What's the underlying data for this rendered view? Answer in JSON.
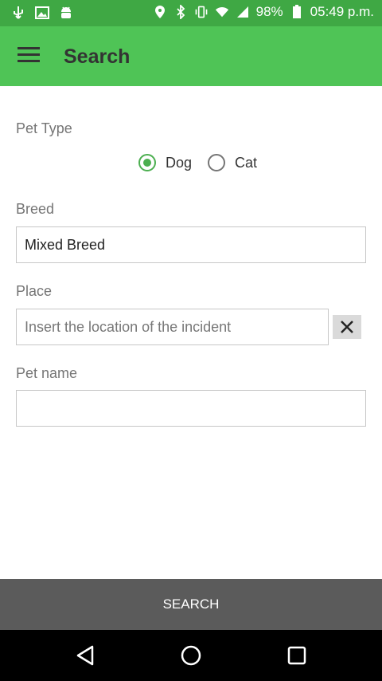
{
  "status_bar": {
    "battery": "98%",
    "time": "05:49 p.m.",
    "left_icons": [
      "usb-icon",
      "image-icon",
      "android-icon"
    ],
    "right_icons": [
      "location-icon",
      "bluetooth-icon",
      "vibrate-icon",
      "wifi-icon",
      "signal-icon",
      "battery-icon"
    ]
  },
  "app_bar": {
    "title": "Search",
    "color": "#4fc456"
  },
  "form": {
    "pet_type_label": "Pet Type",
    "options": [
      "Dog",
      "Cat"
    ],
    "selected_option": "Dog",
    "breed_label": "Breed",
    "breed_value": "Mixed Breed",
    "place_label": "Place",
    "place_placeholder": "Insert the location of the incident",
    "place_value": "",
    "pet_name_label": "Pet name",
    "pet_name_value": ""
  },
  "search_button": {
    "label": "SEARCH"
  },
  "nav_bar": {
    "icons": [
      "back-icon",
      "home-icon",
      "recents-icon"
    ]
  }
}
